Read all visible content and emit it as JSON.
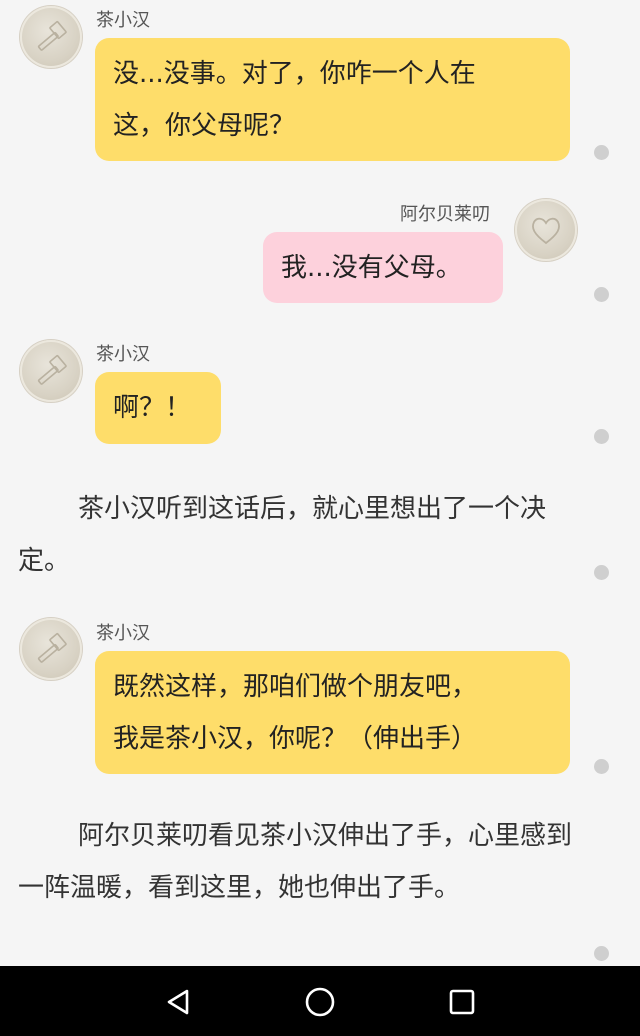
{
  "messages": [
    {
      "sender": "茶小汉",
      "text_lines": [
        "没...没事。对了，你咋一个人在",
        "这，你父母呢？"
      ]
    },
    {
      "sender": "阿尔贝莱叨",
      "text_lines": [
        "我...没有父母。"
      ]
    },
    {
      "sender": "茶小汉",
      "text_lines": [
        "啊？！"
      ]
    },
    {
      "sender": "茶小汉",
      "text_lines": [
        "既然这样，那咱们做个朋友吧，",
        "我是茶小汉，你呢？（伸出手）"
      ]
    }
  ],
  "narrations": [
    {
      "text": "茶小汉听到这话后，就心里想出了一个决定。"
    },
    {
      "text": "阿尔贝莱叨看见茶小汉伸出了手，心里感到一阵温暖，看到这里，她也伸出了手。"
    }
  ],
  "colors": {
    "bubble_left": "#fedd6a",
    "bubble_right": "#fdd1dc",
    "background": "#f5f5f5",
    "navbar": "#000000"
  },
  "navbar": {
    "icons": [
      "back-icon",
      "home-icon",
      "recents-icon"
    ]
  }
}
